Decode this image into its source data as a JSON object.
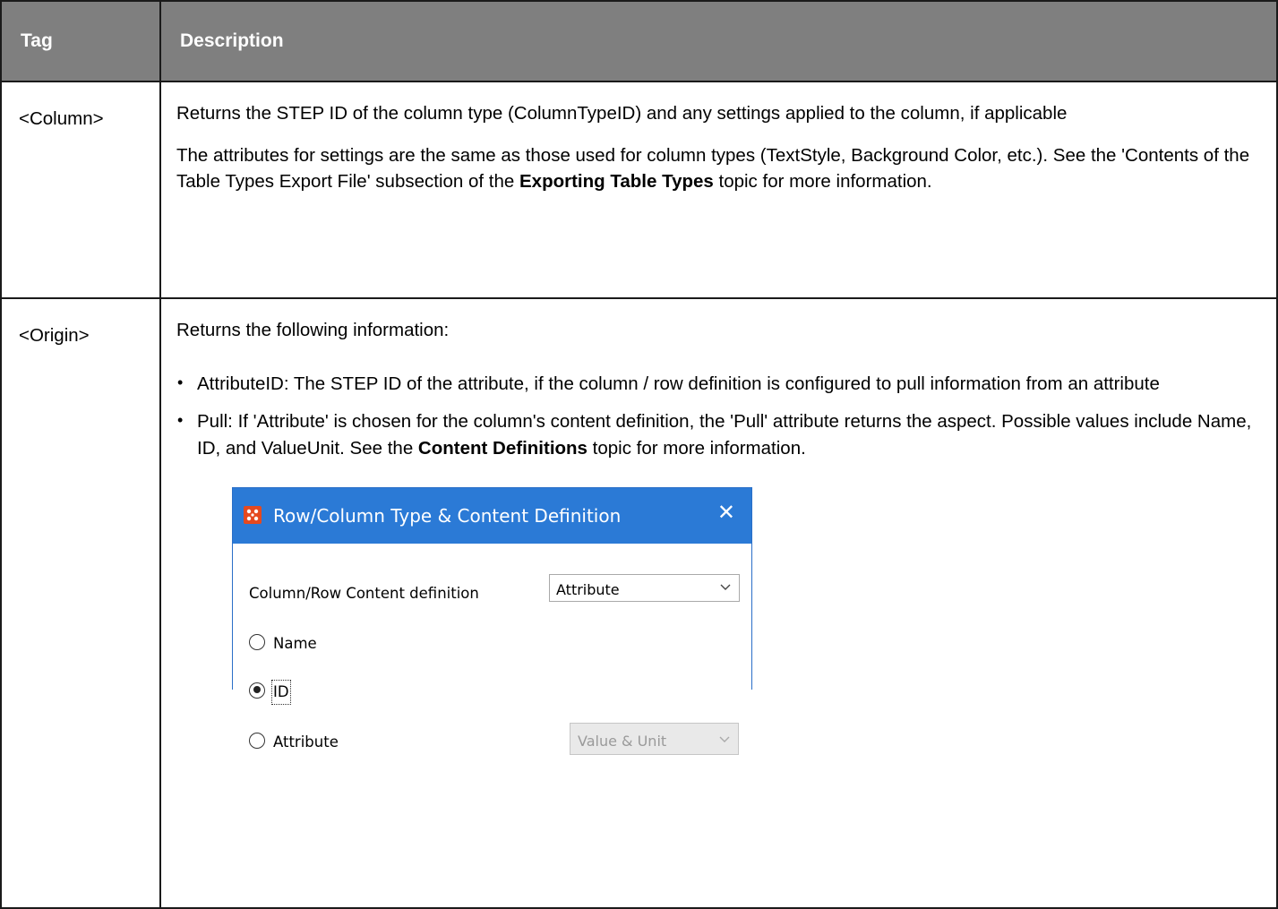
{
  "table": {
    "headers": {
      "tag": "Tag",
      "description": "Description"
    },
    "rows": [
      {
        "tag": "<Column>",
        "para1": "Returns the STEP ID of the column type (ColumnTypeID) and any settings applied to the column, if applicable",
        "para2_before": "The attributes for settings are the same as those used for column types (TextStyle, Background Color, etc.). See the 'Contents of the Table Types Export File' subsection of the ",
        "para2_bold": "Exporting Table Types",
        "para2_after": " topic for more information."
      },
      {
        "tag": "<Origin>",
        "intro": "Returns the following information:",
        "bullet1": "AttributeID: The STEP ID of the attribute, if the column / row definition is configured to pull information from an attribute",
        "bullet2_before": "Pull: If 'Attribute' is chosen for the column's content definition, the 'Pull' attribute returns the aspect. Possible values include Name, ID, and ValueUnit. See the ",
        "bullet2_bold": "Content Definitions",
        "bullet2_after": " topic for more information."
      }
    ]
  },
  "dialog": {
    "title": "Row/Column Type & Content Definition",
    "close_label": "✕",
    "content_label": "Column/Row Content definition",
    "content_value": "Attribute",
    "radio_name": "Name",
    "radio_id": "ID",
    "radio_attribute": "Attribute",
    "attribute_value": "Value & Unit",
    "selected_radio": "ID",
    "title_bar_color": "#2b7ad6",
    "app_icon_color": "#e5491f"
  }
}
